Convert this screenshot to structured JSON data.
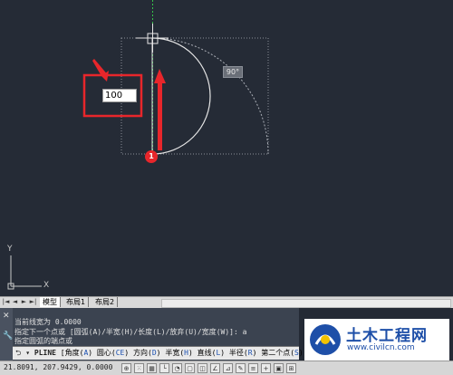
{
  "viewport": {
    "dynamic_input_value": "100",
    "angle_tooltip": "90°",
    "step_badge": "1",
    "ucs_x_label": "X",
    "ucs_y_label": "Y"
  },
  "layout_tabs": {
    "nav_buttons": [
      "|◄",
      "◄",
      "►",
      "►|"
    ],
    "tabs": [
      "模型",
      "布局1",
      "布局2"
    ],
    "active_tab": "模型"
  },
  "command": {
    "history": [
      "当前线宽为 0.0000",
      "指定下一个点或 [圆弧(A)/半宽(H)/长度(L)/放弃(U)/宽度(W)]: a",
      "指定圆弧的端点或"
    ],
    "prompt_command": "PLINE",
    "prompt_options": [
      {
        "label": "角度",
        "key": "A"
      },
      {
        "label": "圆心",
        "key": "CE"
      },
      {
        "label": "方向",
        "key": "D"
      },
      {
        "label": "半宽",
        "key": "H"
      },
      {
        "label": "直线",
        "key": "L"
      },
      {
        "label": "半径",
        "key": "R"
      },
      {
        "label": "第二个点",
        "key": "S"
      }
    ]
  },
  "status": {
    "coordinates": "21.8091,  207.9429, 0.0000"
  },
  "watermark": {
    "title": "土木工程网",
    "url": "www.civilcn.com"
  },
  "colors": {
    "canvas_bg": "#252b36",
    "arc": "#e6e6e6",
    "crosshair_green": "#36c24a",
    "annotation_red": "#e8262b"
  }
}
